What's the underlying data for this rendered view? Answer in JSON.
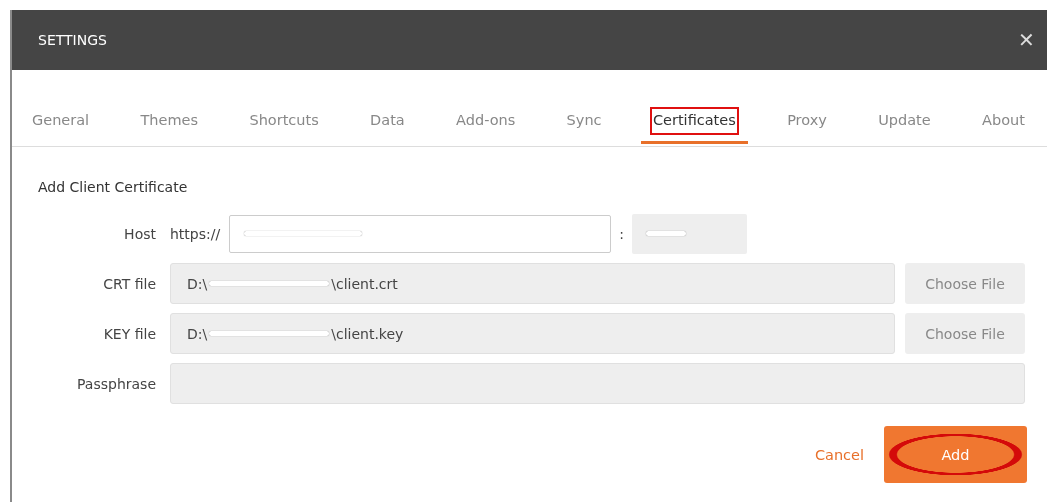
{
  "window": {
    "title": "SETTINGS",
    "close": "✕"
  },
  "tabs": [
    {
      "label": "General",
      "selected": false,
      "highlighted": false
    },
    {
      "label": "Themes",
      "selected": false,
      "highlighted": false
    },
    {
      "label": "Shortcuts",
      "selected": false,
      "highlighted": false
    },
    {
      "label": "Data",
      "selected": false,
      "highlighted": false
    },
    {
      "label": "Add-ons",
      "selected": false,
      "highlighted": false
    },
    {
      "label": "Sync",
      "selected": false,
      "highlighted": false
    },
    {
      "label": "Certificates",
      "selected": true,
      "highlighted": true
    },
    {
      "label": "Proxy",
      "selected": false,
      "highlighted": false
    },
    {
      "label": "Update",
      "selected": false,
      "highlighted": false
    },
    {
      "label": "About",
      "selected": false,
      "highlighted": false
    }
  ],
  "section_title": "Add Client Certificate",
  "host": {
    "label": "Host",
    "scheme": "https://",
    "redacted": true,
    "separator": ":",
    "port_redacted": true
  },
  "files": [
    {
      "label": "CRT file",
      "value_start": "D:\\",
      "redacted": true,
      "value_end": "\\client.crt",
      "button": "Choose File"
    },
    {
      "label": "KEY file",
      "value_start": "D:\\",
      "redacted": true,
      "value_end": "\\client.key",
      "button": "Choose File"
    }
  ],
  "passphrase": {
    "label": "Passphrase"
  },
  "cancel_button": "Cancel",
  "add_button": {
    "label": "Add",
    "highlighted": true
  }
}
